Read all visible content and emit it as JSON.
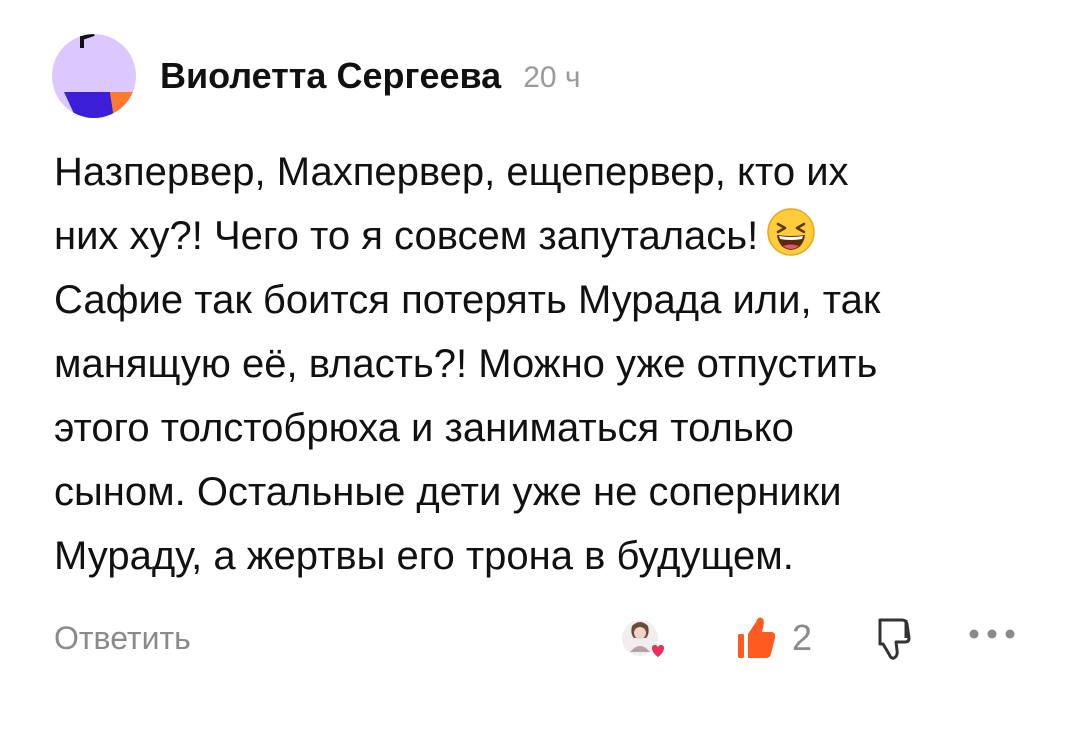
{
  "comment": {
    "author": "Виолетта Сергеева",
    "timestamp": "20 ч",
    "text_line_1": "Назпервер, Махпервер, ещепервер, кто их",
    "text_line_2": "них ху?! Чего то я совсем запуталась!",
    "text_line_3": "Сафие так боится потерять Мурада или, так",
    "text_line_4": "манящую её, власть?! Можно уже отпустить",
    "text_line_5": "этого толстобрюха и заниматься только",
    "text_line_6": "сыном. Остальные дети уже не соперники",
    "text_line_7": "Мураду, а жертвы его трона в будущем.",
    "emoji": "laughing-squinting-face"
  },
  "actions": {
    "reply_label": "Ответить",
    "like_count": "2",
    "like_icon": "thumbs-up-icon",
    "dislike_icon": "thumbs-down-icon",
    "more_icon": "more-dots-icon",
    "reactor_avatar": "reactor-avatar-with-heart"
  },
  "colors": {
    "avatar_bg": "#dcc8ff",
    "avatar_accent_blue": "#3b1fd8",
    "avatar_accent_orange": "#ff7a2e",
    "like_orange": "#ff5a1f",
    "muted_text": "#8a8a8a"
  }
}
